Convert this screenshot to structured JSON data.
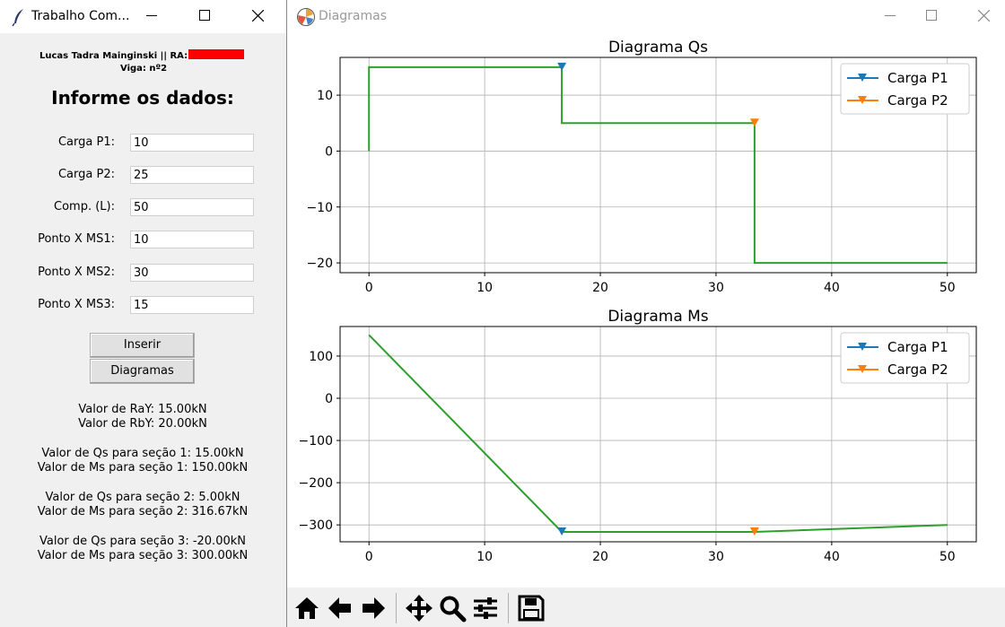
{
  "left_window": {
    "title": "Trabalho Com...",
    "author": "Lucas Tadra Mainginski || RA:",
    "viga": "Viga: nº2",
    "form_title": "Informe os dados:",
    "fields": [
      {
        "label": "Carga P1:",
        "value": "10"
      },
      {
        "label": "Carga P2:",
        "value": "25"
      },
      {
        "label": "Comp. (L):",
        "value": "50"
      },
      {
        "label": "Ponto X MS1:",
        "value": "10"
      },
      {
        "label": "Ponto X MS2:",
        "value": "30"
      },
      {
        "label": "Ponto X MS3:",
        "value": "15"
      }
    ],
    "buttons": {
      "inserir": "Inserir",
      "diagramas": "Diagramas"
    },
    "results": {
      "ray": "Valor de RaY: 15.00kN",
      "rby": "Valor de RbY: 20.00kN",
      "qs1": "Valor de Qs para seção 1: 15.00kN",
      "ms1": "Valor de Ms para seção 1: 150.00kN",
      "qs2": "Valor de Qs para seção 2: 5.00kN",
      "ms2": "Valor de Ms para seção 2: 316.67kN",
      "qs3": "Valor de Qs para seção 3: -20.00kN",
      "ms3": "Valor de Ms para seção 3: 300.00kN"
    }
  },
  "right_window": {
    "title": "Diagramas",
    "toolbar": [
      "home-icon",
      "back-arrow-icon",
      "forward-arrow-icon",
      "pan-icon",
      "zoom-icon",
      "configure-subplots-icon",
      "save-icon"
    ]
  },
  "colors": {
    "line": "#2ca02c",
    "p1": "#1f77b4",
    "p2": "#ff7f0e",
    "redaction": "#ff0000"
  },
  "chart_data": [
    {
      "type": "line",
      "title": "Diagrama Qs",
      "xlim": [
        -2.5,
        52.5
      ],
      "ylim": [
        -21.75,
        16.75
      ],
      "xticks": [
        0,
        10,
        20,
        30,
        40,
        50
      ],
      "yticks": [
        -20,
        -10,
        0,
        10
      ],
      "ytick_labels": [
        "−20",
        "−10",
        "0",
        "10"
      ],
      "grid": true,
      "legend": "top-right",
      "line": {
        "x": [
          0,
          0,
          16.67,
          16.67,
          33.33,
          33.33,
          50
        ],
        "y": [
          0,
          15,
          15,
          5,
          5,
          -20,
          -20
        ]
      },
      "series": [
        {
          "name": "Carga P1",
          "x": [
            16.67
          ],
          "y": [
            15
          ]
        },
        {
          "name": "Carga P2",
          "x": [
            33.33
          ],
          "y": [
            5
          ]
        }
      ]
    },
    {
      "type": "line",
      "title": "Diagrama Ms",
      "xlim": [
        -2.5,
        52.5
      ],
      "ylim": [
        -340,
        170
      ],
      "xticks": [
        0,
        10,
        20,
        30,
        40,
        50
      ],
      "yticks": [
        -300,
        -200,
        -100,
        0,
        100
      ],
      "ytick_labels": [
        "−300",
        "−200",
        "−100",
        "0",
        "100"
      ],
      "grid": true,
      "legend": "top-right",
      "line": {
        "x": [
          0,
          16.67,
          33.33,
          50
        ],
        "y": [
          150,
          -316.67,
          -316.67,
          -300
        ]
      },
      "series": [
        {
          "name": "Carga P1",
          "x": [
            16.67
          ],
          "y": [
            -316.67
          ]
        },
        {
          "name": "Carga P2",
          "x": [
            33.33
          ],
          "y": [
            -316.67
          ]
        }
      ]
    }
  ]
}
